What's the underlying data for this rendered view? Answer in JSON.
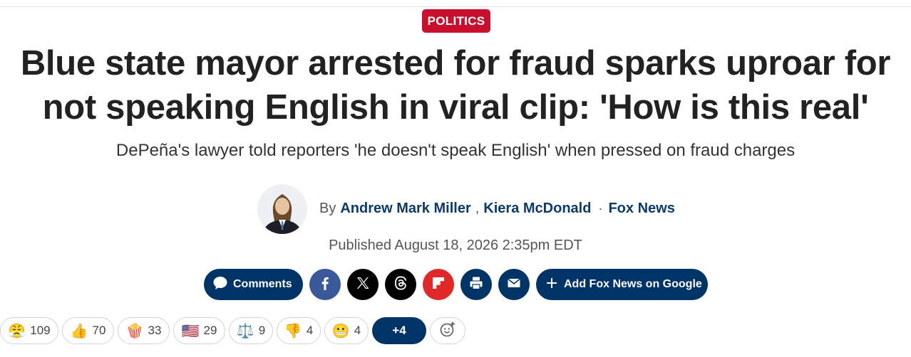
{
  "article": {
    "category": "POLITICS",
    "headline_line1": "Blue state mayor arrested for fraud sparks uproar for",
    "headline_line2": "not speaking English in viral clip: 'How is this real'",
    "subheadline": "DePeña's lawyer told reporters 'he doesn't speak English' when pressed on fraud charges",
    "byline": {
      "prefix": "By",
      "authors": [
        "Andrew Mark Miller",
        "Kiera McDonald"
      ],
      "separator": ",",
      "dot": "·",
      "outlet": "Fox News"
    },
    "published": "Published August 18, 2026 2:35pm EDT"
  },
  "share": {
    "comments_label": "Comments",
    "icons": [
      "facebook-icon",
      "x-icon",
      "threads-icon",
      "flipboard-icon",
      "print-icon",
      "email-icon"
    ],
    "add_google_label": "Add Fox News on Google"
  },
  "colors": {
    "category_bg": "#c8102e",
    "brand_navy": "#003366",
    "author_link": "#0b3a6b",
    "facebook": "#3b5998",
    "flipboard": "#e12828",
    "black": "#000000"
  },
  "reactions": [
    {
      "emoji": "😤",
      "name": "angry",
      "count": "109"
    },
    {
      "emoji": "👍",
      "name": "thumbs-up",
      "count": "70"
    },
    {
      "emoji": "🍿",
      "name": "popcorn",
      "count": "33"
    },
    {
      "emoji": "🇺🇸",
      "name": "us-flag",
      "count": "29"
    },
    {
      "emoji": "⚖️",
      "name": "scales",
      "count": "9"
    },
    {
      "emoji": "👎",
      "name": "thumbs-down",
      "count": "4"
    },
    {
      "emoji": "😬",
      "name": "grimace",
      "count": "4"
    }
  ],
  "reactions_more": "+4"
}
